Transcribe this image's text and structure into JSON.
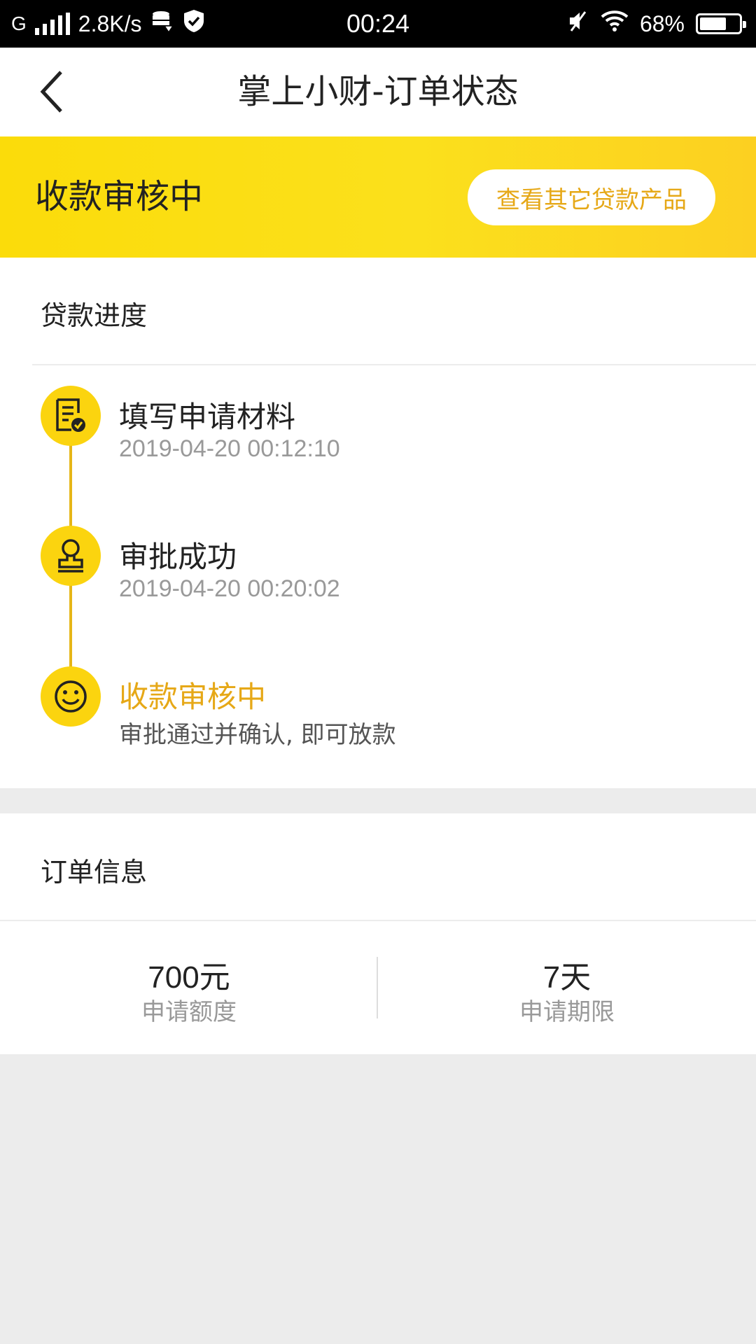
{
  "status_bar": {
    "network": "G",
    "speed": "2.8K/s",
    "time": "00:24",
    "battery": "68%",
    "battery_level": 0.68
  },
  "nav": {
    "title": "掌上小财-订单状态"
  },
  "banner": {
    "status": "收款审核中",
    "button_label": "查看其它贷款产品"
  },
  "progress": {
    "title": "贷款进度",
    "steps": [
      {
        "title": "填写申请材料",
        "sub": "2019-04-20 00:12:10",
        "icon": "document-check-icon"
      },
      {
        "title": "审批成功",
        "sub": "2019-04-20 00:20:02",
        "icon": "stamp-icon"
      },
      {
        "title": "收款审核中",
        "sub": "审批通过并确认, 即可放款",
        "icon": "smiley-icon"
      }
    ]
  },
  "order": {
    "title": "订单信息",
    "amount_value": "700元",
    "amount_label": "申请额度",
    "term_value": "7天",
    "term_label": "申请期限"
  },
  "colors": {
    "accent": "#fbd40f",
    "accent_text": "#e6a817",
    "background": "#ececec"
  }
}
